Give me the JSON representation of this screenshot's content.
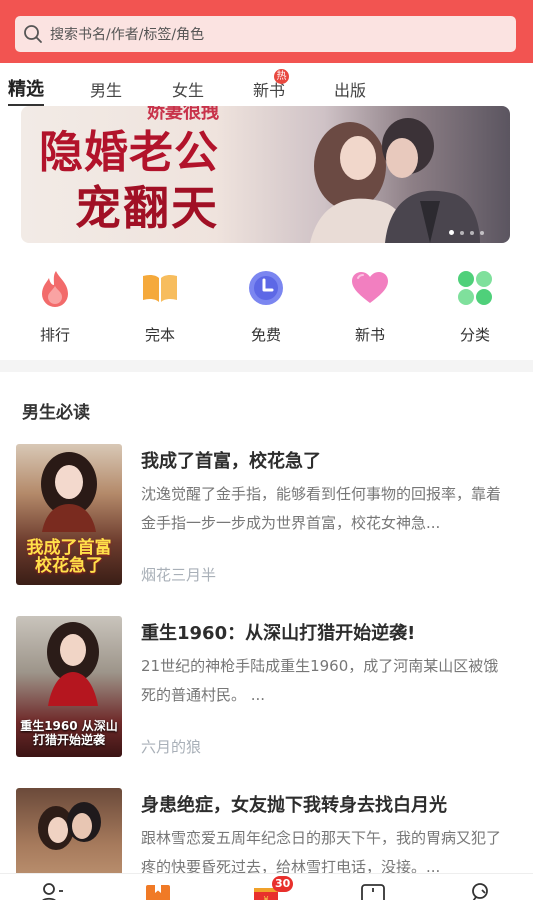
{
  "search": {
    "placeholder": "搜索书名/作者/标签/角色"
  },
  "tabs": [
    {
      "label": "精选",
      "active": true
    },
    {
      "label": "男生"
    },
    {
      "label": "女生"
    },
    {
      "label": "新书",
      "badge": "热"
    },
    {
      "label": "出版"
    }
  ],
  "banner": {
    "subtitle": "娇妻很拽",
    "title_line1": "隐婚老公",
    "title_line2": "宠翻天",
    "slide_count": 4,
    "current_slide": 1
  },
  "quick_links": [
    {
      "label": "排行",
      "icon": "flame-icon",
      "color": "#f26b6b"
    },
    {
      "label": "完本",
      "icon": "open-book-icon",
      "color": "#f5a93b"
    },
    {
      "label": "免费",
      "icon": "clock-icon",
      "color": "#7b86f0"
    },
    {
      "label": "新书",
      "icon": "heart-icon",
      "color": "#f27fc0"
    },
    {
      "label": "分类",
      "icon": "clover-icon",
      "color": "#4fd07a"
    }
  ],
  "section": {
    "title": "男生必读"
  },
  "books": [
    {
      "title": "我成了首富，校花急了",
      "description": "沈逸觉醒了金手指，能够看到任何事物的回报率，靠着金手指一步一步成为世界首富，校花女神急...",
      "author": "烟花三月半",
      "cover_text": "我成了首富校花急了"
    },
    {
      "title": "重生1960：从深山打猎开始逆袭!",
      "description": "21世纪的神枪手陆成重生1960，成了河南某山区被饿死的普通村民。 ...",
      "author": "六月的狼",
      "cover_text": "重生1960 从深山打猎开始逆袭"
    },
    {
      "title": "身患绝症，女友抛下我转身去找白月光",
      "description": "跟林雪恋爱五周年纪念日的那天下午，我的胃病又犯了疼的快要昏死过去，给林雪打电话，没接。...",
      "author": "",
      "cover_text": ""
    }
  ],
  "bottom_nav": {
    "items": [
      "profile-card-icon",
      "bookshelf-icon",
      "gift-icon",
      "shop-bag-icon",
      "user-icon"
    ],
    "active": 1,
    "gift_badge": "30"
  }
}
